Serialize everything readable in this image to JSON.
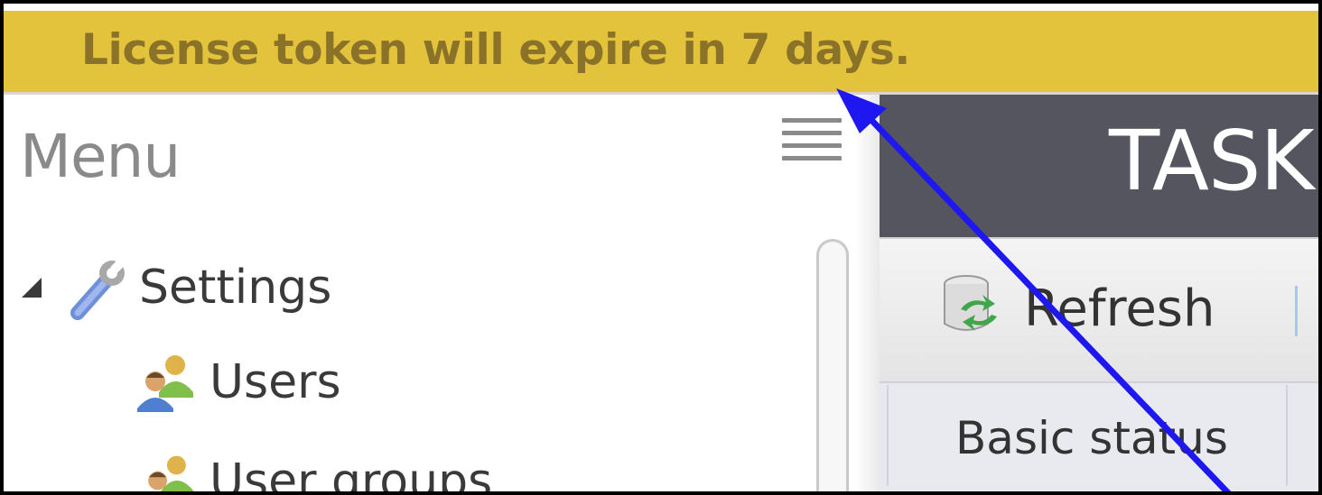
{
  "banner": {
    "text": "License token will expire in 7 days.",
    "color": "#e4c33c"
  },
  "menu": {
    "title": "Menu",
    "items": [
      {
        "label": "Settings",
        "icon": "wrench-icon",
        "expanded": true
      },
      {
        "label": "Users",
        "icon": "users-icon"
      },
      {
        "label": "User groups",
        "icon": "user-groups-icon"
      }
    ]
  },
  "task_panel": {
    "title": "TASK",
    "toolbar": {
      "refresh_label": "Refresh",
      "refresh_icon": "database-refresh-icon"
    },
    "columns": [
      "Basic status"
    ]
  },
  "annotation": {
    "arrow_color": "#1f17f0"
  }
}
